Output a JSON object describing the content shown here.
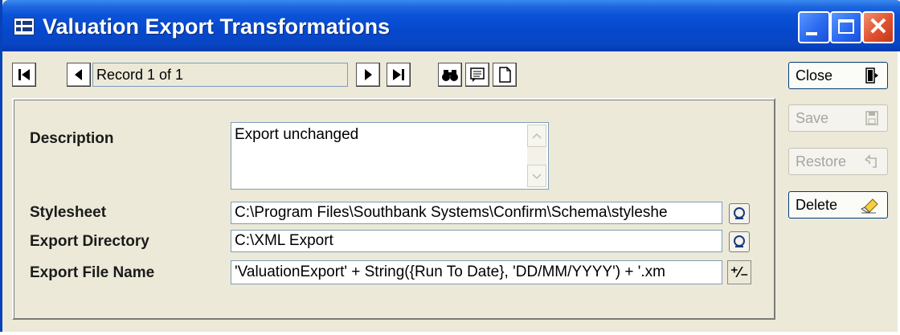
{
  "window": {
    "title": "Valuation Export Transformations"
  },
  "icons": {
    "app": "form-icon",
    "first": "first-record-icon",
    "prev": "previous-record-icon",
    "next": "next-record-icon",
    "last": "last-record-icon",
    "find": "binoculars-icon",
    "notes": "notes-icon",
    "new": "new-document-icon",
    "close": "exit-door-icon",
    "save": "save-icon",
    "restore": "undo-arrow-icon",
    "delete": "eraser-icon",
    "lookup": "lookup-icon"
  },
  "toolbar": {
    "record_status": "Record 1 of 1"
  },
  "form": {
    "description": {
      "label": "Description",
      "value": "Export unchanged"
    },
    "stylesheet": {
      "label": "Stylesheet",
      "value": "C:\\Program Files\\Southbank Systems\\Confirm\\Schema\\styleshe"
    },
    "export_directory": {
      "label": "Export Directory",
      "value": "C:\\XML Export"
    },
    "export_file_name": {
      "label": "Export File Name",
      "value": "'ValuationExport' + String({Run To Date}, 'DD/MM/YYYY') + '.xm",
      "expr_button": "⁺⁄₋"
    }
  },
  "actions": {
    "close": "Close",
    "save": "Save",
    "restore": "Restore",
    "delete": "Delete"
  },
  "colors": {
    "titlebar": "#0a52d8",
    "window_bg": "#ece9d8",
    "close_button": "#e05030",
    "disabled_text": "#a6a6a0"
  }
}
